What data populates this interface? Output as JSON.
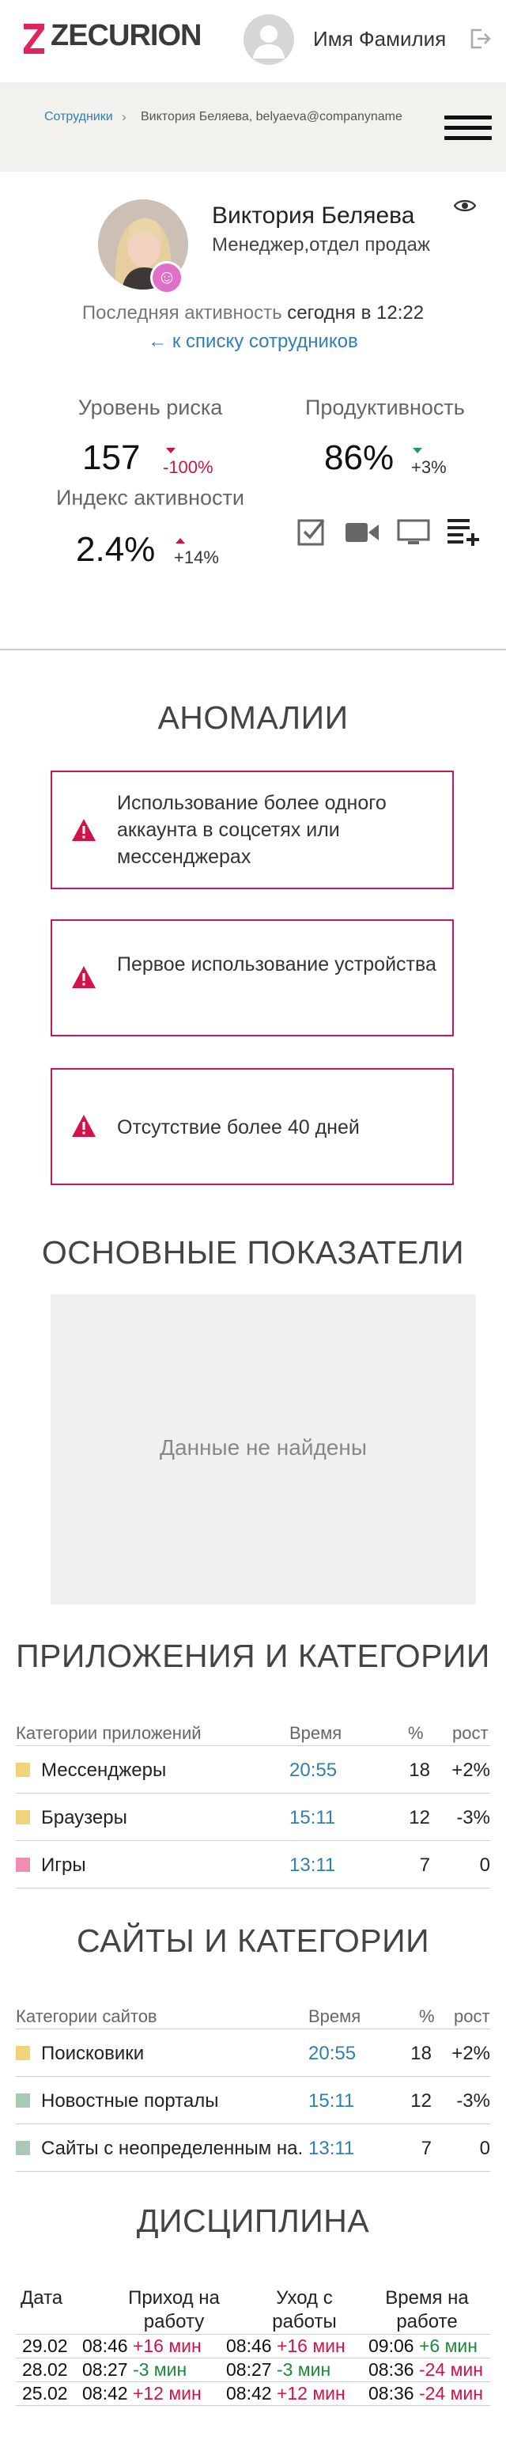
{
  "header": {
    "logo_text": "ZECURION",
    "user_name": "Имя Фамилия",
    "logout_icon": "logout-icon",
    "brand_color": "#e0245e"
  },
  "breadcrumb": {
    "parent": "Сотрудники",
    "current": "Виктория Беляева, belyaeva@companyname"
  },
  "profile": {
    "name": "Виктория Беляева",
    "position": "Менеджер,отдел продаж",
    "last_activity_label": "Последняя активность",
    "last_activity_value": "сегодня в 12:22",
    "back_link": "к списку сотрудников"
  },
  "stats": {
    "risk": {
      "label": "Уровень риска",
      "value": "157",
      "delta": "-100%"
    },
    "productivity": {
      "label": "Продуктивность",
      "value": "86%",
      "delta": "+3%"
    },
    "activity_index": {
      "label": "Индекс активности",
      "value": "2.4%",
      "delta": "+14%"
    }
  },
  "anomalies": {
    "title": "АНОМАЛИИ",
    "items": [
      {
        "text": "Использование более одного аккаунта в соцсетях или мессенджерах"
      },
      {
        "text": "Первое использование устройства"
      },
      {
        "text": "Отсутствие более 40 дней"
      }
    ]
  },
  "main_indicators": {
    "title": "ОСНОВНЫЕ ПОКАЗАТЕЛИ",
    "empty_text": "Данные не найдены"
  },
  "apps": {
    "title": "ПРИЛОЖЕНИЯ И КАТЕГОРИИ",
    "columns": [
      "Категории приложений",
      "Время",
      "%",
      "рост"
    ],
    "rows": [
      {
        "name": "Мессенджеры",
        "time": "20:55",
        "pct": "18",
        "growth": "+2%",
        "color": "#f2d27a"
      },
      {
        "name": "Браузеры",
        "time": "15:11",
        "pct": "12",
        "growth": "-3%",
        "color": "#f2d27a"
      },
      {
        "name": "Игры",
        "time": "13:11",
        "pct": "7",
        "growth": "0",
        "color": "#ef8fb0"
      }
    ]
  },
  "sites": {
    "title": "САЙТЫ И КАТЕГОРИИ",
    "columns": [
      "Категории сайтов",
      "Время",
      "%",
      "рост"
    ],
    "rows": [
      {
        "name": "Поисковики",
        "time": "20:55",
        "pct": "18",
        "growth": "+2%",
        "color": "#f2d27a"
      },
      {
        "name": "Новостные порталы",
        "time": "15:11",
        "pct": "12",
        "growth": "-3%",
        "color": "#a9c9b4"
      },
      {
        "name": "Сайты с неопределенным на...",
        "time": "13:11",
        "pct": "7",
        "growth": "0",
        "color": "#a9c9b4"
      }
    ]
  },
  "discipline": {
    "title": "ДИСЦИПЛИНА",
    "columns": [
      "Дата",
      "Приход на работу",
      "Уход с работы",
      "Время на работе"
    ],
    "rows": [
      {
        "date": "29.02",
        "in": "08:46",
        "in_delta": "+16 мин",
        "out": "08:46",
        "out_delta": "+16 мин",
        "total": "09:06",
        "total_delta": "+6 мин"
      },
      {
        "date": "28.02",
        "in": "08:27",
        "in_delta": "-3 мин",
        "out": "08:27",
        "out_delta": "-3 мин",
        "total": "08:36",
        "total_delta": "-24 мин"
      },
      {
        "date": "25.02",
        "in": "08:42",
        "in_delta": "+12 мин",
        "out": "08:42",
        "out_delta": "+12 мин",
        "total": "08:36",
        "total_delta": "-24 мин"
      }
    ]
  }
}
